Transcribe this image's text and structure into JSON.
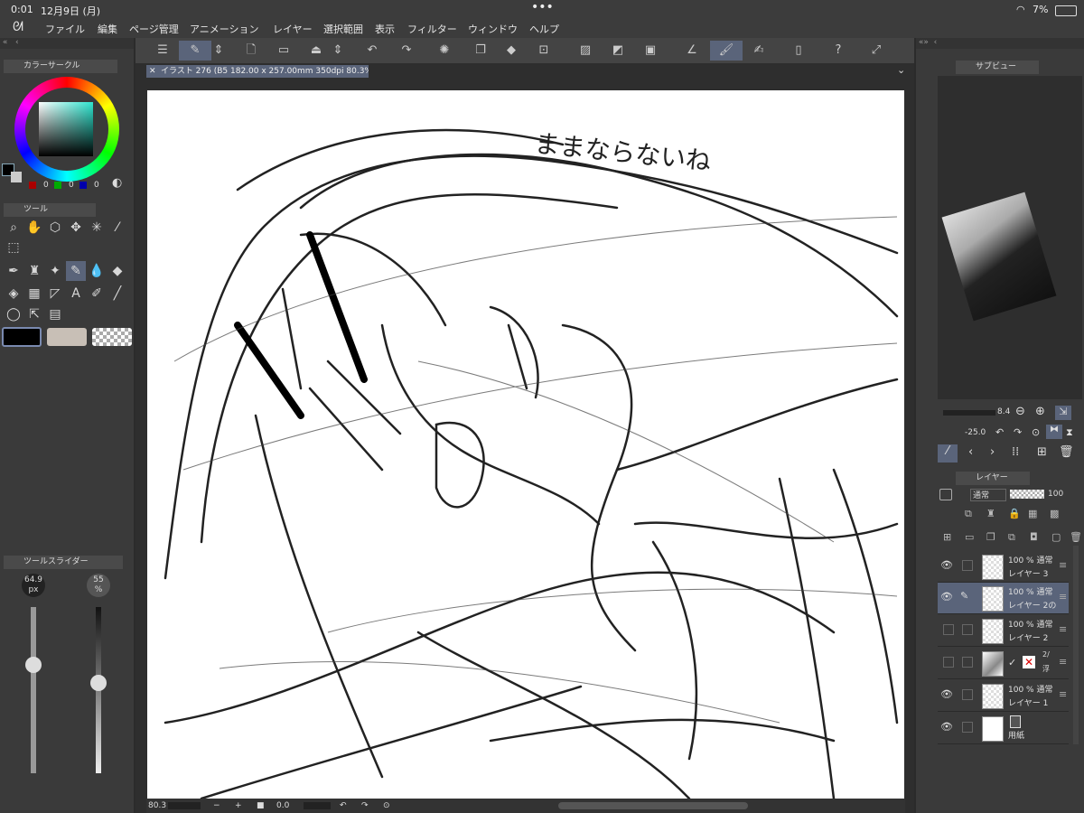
{
  "status": {
    "time": "0:01",
    "date": "12月9日 (月)",
    "battery": "7%"
  },
  "menu": [
    "ファイル",
    "編集",
    "ページ管理",
    "アニメーション",
    "レイヤー",
    "選択範囲",
    "表示",
    "フィルター",
    "ウィンドウ",
    "ヘルプ"
  ],
  "canvas_tab": "イラスト 276 (B5 182.00 x 257.00mm 350dpi 80.3%)",
  "canvas_text": "ままならないね",
  "panels": {
    "color_circle": "カラーサークル",
    "tool": "ツール",
    "tool_slider": "ツールスライダー",
    "sub_view": "サブビュー",
    "layer": "レイヤー"
  },
  "color_values": {
    "r": "0",
    "g": "0",
    "b": "0"
  },
  "sliders": {
    "size_value": "64.9",
    "size_unit": "px",
    "opacity_value": "55",
    "opacity_unit": "%"
  },
  "subview": {
    "zoom": "8.4",
    "rotate": "-25.0"
  },
  "layer_panel": {
    "blend": "通常",
    "opacity": "100"
  },
  "layers": [
    {
      "opacity": "100 %",
      "blend": "通常",
      "name": "レイヤー 3"
    },
    {
      "opacity": "100 %",
      "blend": "通常",
      "name": "レイヤー 2の"
    },
    {
      "opacity": "100 %",
      "blend": "通常",
      "name": "レイヤー 2"
    },
    {
      "opacity": "2/",
      "blend": "",
      "name": "浮"
    },
    {
      "opacity": "100 %",
      "blend": "通常",
      "name": "レイヤー 1"
    },
    {
      "opacity": "",
      "blend": "",
      "name": "用紙"
    }
  ],
  "bottom_bar": {
    "zoom": "80.3",
    "rotate": "0.0"
  },
  "colors": {
    "accent": "#5a647a",
    "panel": "#3a3a3a",
    "bg": "#2b2b2b"
  }
}
